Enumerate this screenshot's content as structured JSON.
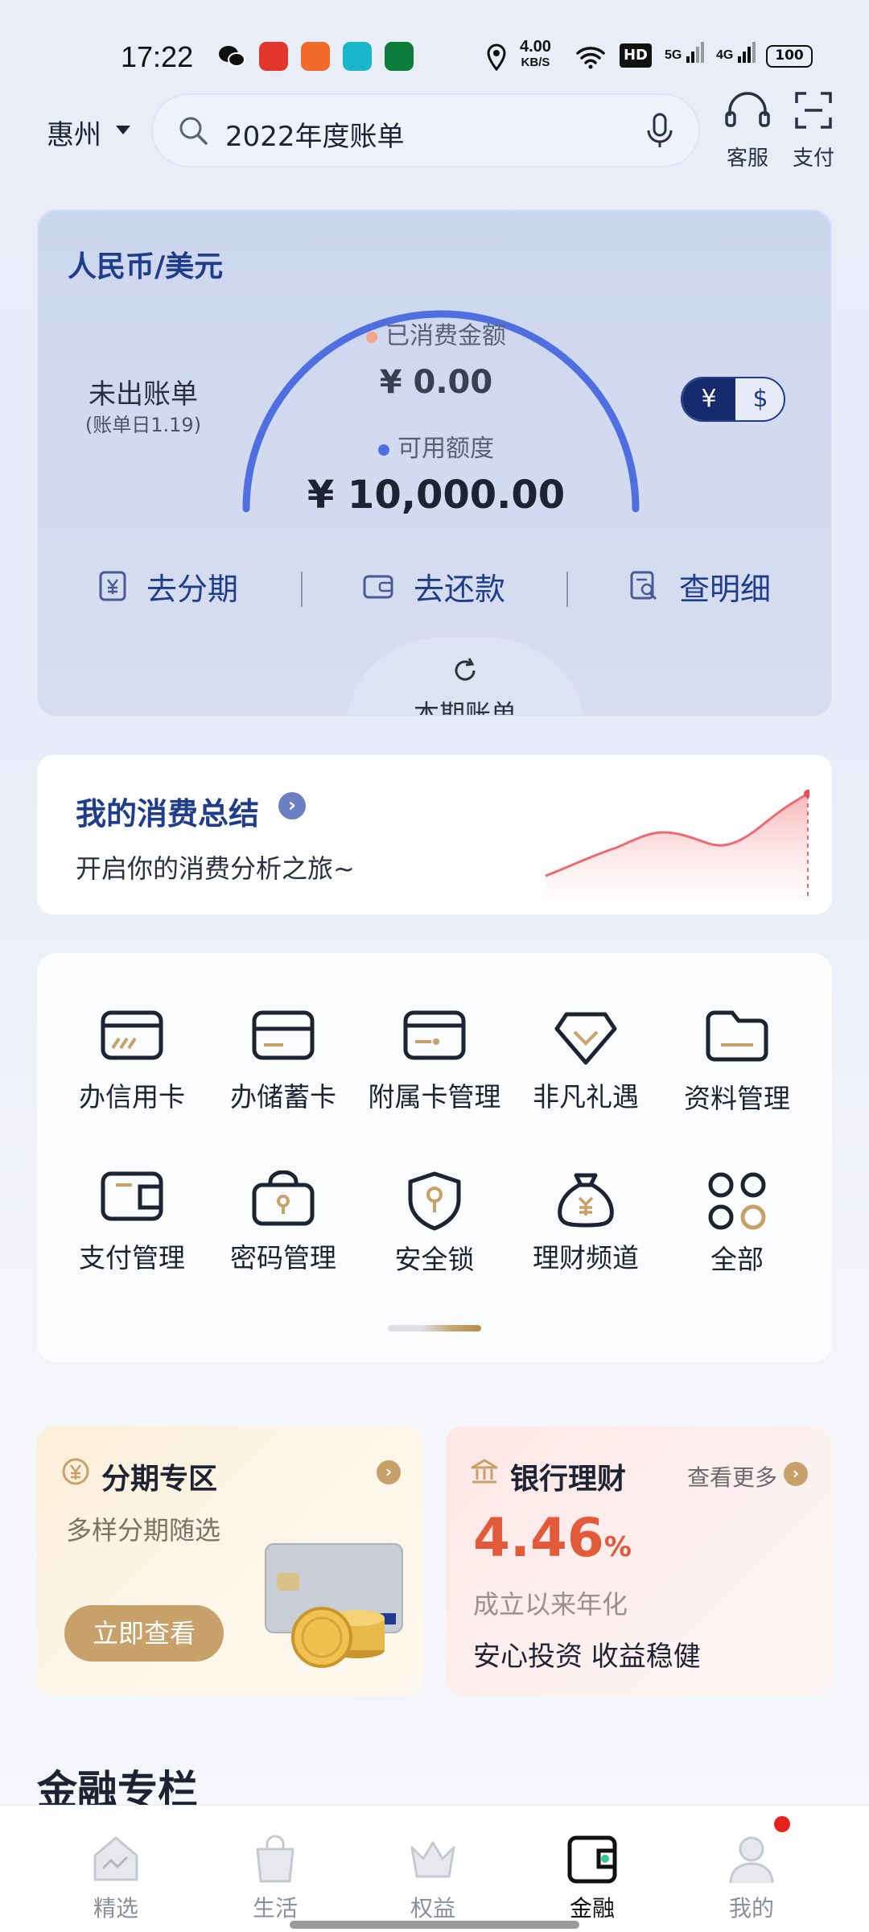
{
  "status_bar": {
    "time": "17:22",
    "net_speed_value": "4.00",
    "net_speed_unit": "KB/S",
    "hd": "HD",
    "sig1": "5G",
    "sig2": "4G",
    "battery": "100"
  },
  "header": {
    "city": "惠州",
    "search_text": "2022年度账单",
    "service_label": "客服",
    "pay_label": "支付"
  },
  "card": {
    "currency_title": "人民币/美元",
    "unbilled_label": "未出账单",
    "bill_day": "(账单日1.19)",
    "spent_label": "已消费金额",
    "spent_value": "¥ 0.00",
    "available_label": "可用额度",
    "available_value": "¥ 10,000.00",
    "toggle_cny": "¥",
    "toggle_usd": "$",
    "actions": [
      {
        "label": "去分期"
      },
      {
        "label": "去还款"
      },
      {
        "label": "查明细"
      }
    ],
    "bill_tab": "本期账单"
  },
  "summary": {
    "title": "我的消费总结",
    "subtitle": "开启你的消费分析之旅~"
  },
  "grid": {
    "items": [
      {
        "label": "办信用卡",
        "icon": "credit-card-icon"
      },
      {
        "label": "办储蓄卡",
        "icon": "debit-card-icon"
      },
      {
        "label": "附属卡管理",
        "icon": "supplementary-card-icon"
      },
      {
        "label": "非凡礼遇",
        "icon": "gift-icon"
      },
      {
        "label": "资料管理",
        "icon": "folder-icon"
      },
      {
        "label": "支付管理",
        "icon": "wallet-icon"
      },
      {
        "label": "密码管理",
        "icon": "lock-icon"
      },
      {
        "label": "安全锁",
        "icon": "shield-key-icon"
      },
      {
        "label": "理财频道",
        "icon": "money-bag-icon"
      },
      {
        "label": "全部",
        "icon": "grid-icon"
      }
    ]
  },
  "promos": {
    "installment": {
      "title": "分期专区",
      "subtitle": "多样分期随选",
      "button": "立即查看"
    },
    "wealth": {
      "title": "银行理财",
      "more": "查看更多",
      "rate": "4.46",
      "rate_unit": "%",
      "rate_desc": "成立以来年化",
      "slogan": "安心投资 收益稳健"
    }
  },
  "section_title": "金融专栏",
  "bottom_nav": {
    "items": [
      {
        "label": "精选"
      },
      {
        "label": "生活"
      },
      {
        "label": "权益"
      },
      {
        "label": "金融"
      },
      {
        "label": "我的"
      }
    ],
    "active": "金融"
  },
  "colors": {
    "brand_blue": "#1f3d8a",
    "gauge_blue": "#4f6fe0",
    "spent_dot": "#f0a58a",
    "gold": "#c7a06a",
    "rate_red": "#e35a3a"
  }
}
